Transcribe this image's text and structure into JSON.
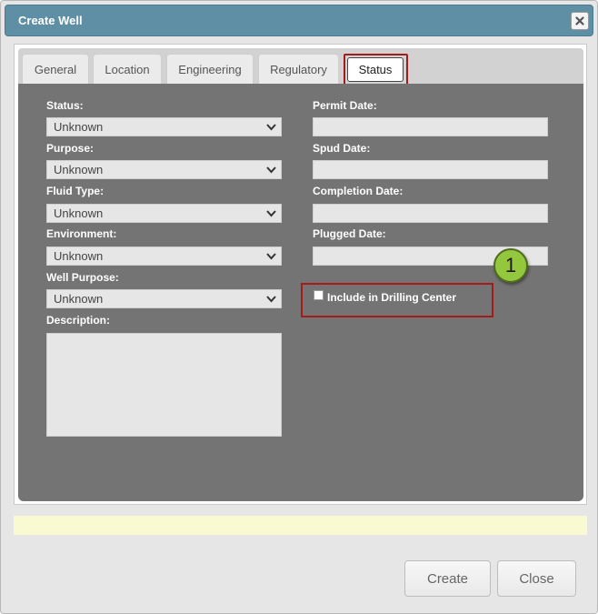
{
  "dialog": {
    "title": "Create Well",
    "close_icon": "close-icon"
  },
  "tabs": [
    {
      "label": "General",
      "active": false
    },
    {
      "label": "Location",
      "active": false
    },
    {
      "label": "Engineering",
      "active": false
    },
    {
      "label": "Regulatory",
      "active": false
    },
    {
      "label": "Status",
      "active": true
    }
  ],
  "form": {
    "status": {
      "label": "Status:",
      "value": "Unknown"
    },
    "purpose": {
      "label": "Purpose:",
      "value": "Unknown"
    },
    "fluid_type": {
      "label": "Fluid Type:",
      "value": "Unknown"
    },
    "environment": {
      "label": "Environment:",
      "value": "Unknown"
    },
    "well_purpose": {
      "label": "Well Purpose:",
      "value": "Unknown"
    },
    "description": {
      "label": "Description:",
      "value": ""
    },
    "permit_date": {
      "label": "Permit Date:",
      "value": ""
    },
    "spud_date": {
      "label": "Spud Date:",
      "value": ""
    },
    "completion_date": {
      "label": "Completion Date:",
      "value": ""
    },
    "plugged_date": {
      "label": "Plugged Date:",
      "value": ""
    },
    "drilling_center": {
      "label": "Include in Drilling Center",
      "checked": false
    }
  },
  "callout": {
    "number": "1",
    "color": "#93c83e"
  },
  "highlight_color": "#a31b1b",
  "buttons": {
    "create_label": "Create",
    "close_label": "Close"
  },
  "colors": {
    "titlebar": "#5e8fa5",
    "content_bg": "#747474",
    "message_bar": "#fafad2"
  }
}
